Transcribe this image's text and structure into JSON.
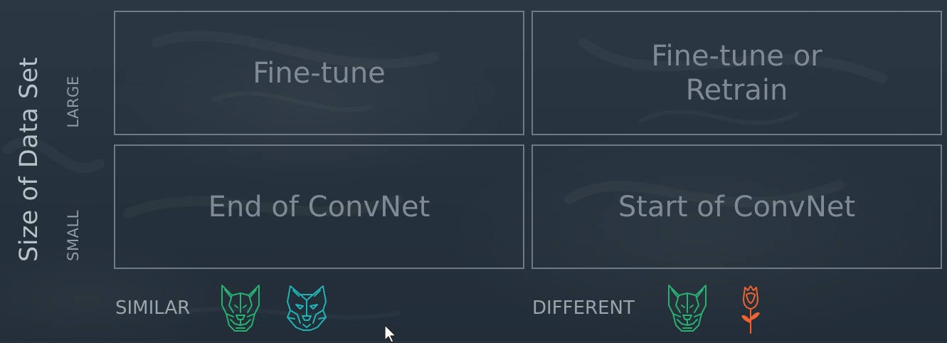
{
  "y_axis": {
    "title": "Size of Data Set",
    "rows": [
      "LARGE",
      "SMALL"
    ]
  },
  "x_axis": {
    "columns": [
      "SIMILAR",
      "DIFFERENT"
    ]
  },
  "cells": [
    {
      "row": "LARGE",
      "column": "SIMILAR",
      "text": "Fine-tune"
    },
    {
      "row": "LARGE",
      "column": "DIFFERENT",
      "text": "Fine-tune or Retrain"
    },
    {
      "row": "SMALL",
      "column": "SIMILAR",
      "text": "End of ConvNet"
    },
    {
      "row": "SMALL",
      "column": "DIFFERENT",
      "text": "Start of ConvNet"
    }
  ],
  "icons": {
    "similar": [
      "dog-icon",
      "wolf-icon"
    ],
    "different": [
      "dog-icon",
      "rose-icon"
    ]
  },
  "colors": {
    "background": "#26323d",
    "cell_border": "#6f7a84",
    "cell_text": "#7f8a94",
    "dog_green": "#27b072",
    "wolf_teal": "#1fb3b6",
    "rose_orange": "#f0622f"
  }
}
